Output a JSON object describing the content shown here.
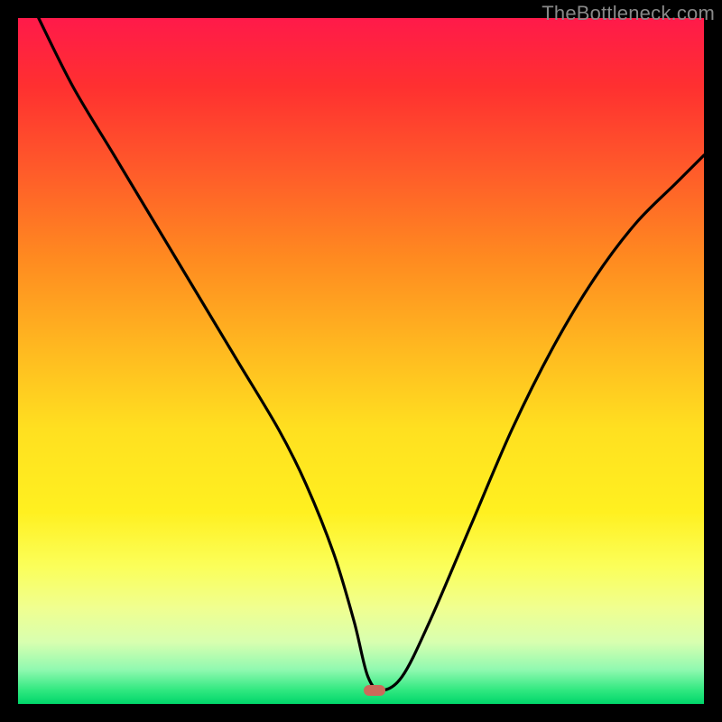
{
  "watermark": "TheBottleneck.com",
  "chart_data": {
    "type": "line",
    "title": "",
    "xlabel": "",
    "ylabel": "",
    "xlim": [
      0,
      100
    ],
    "ylim": [
      0,
      100
    ],
    "grid": false,
    "legend": false,
    "annotations": [
      {
        "type": "marker",
        "x": 52,
        "y": 2,
        "color": "#cc6a5a"
      }
    ],
    "series": [
      {
        "name": "curve",
        "x": [
          3,
          8,
          14,
          20,
          26,
          32,
          38,
          42,
          46,
          49,
          51,
          53,
          56,
          60,
          66,
          72,
          78,
          84,
          90,
          96,
          100
        ],
        "y": [
          100,
          90,
          80,
          70,
          60,
          50,
          40,
          32,
          22,
          12,
          4,
          2,
          4,
          12,
          26,
          40,
          52,
          62,
          70,
          76,
          80
        ]
      }
    ],
    "background_gradient": {
      "top": "#ff1a4a",
      "mid": "#ffe020",
      "bottom": "#00d66a"
    }
  }
}
